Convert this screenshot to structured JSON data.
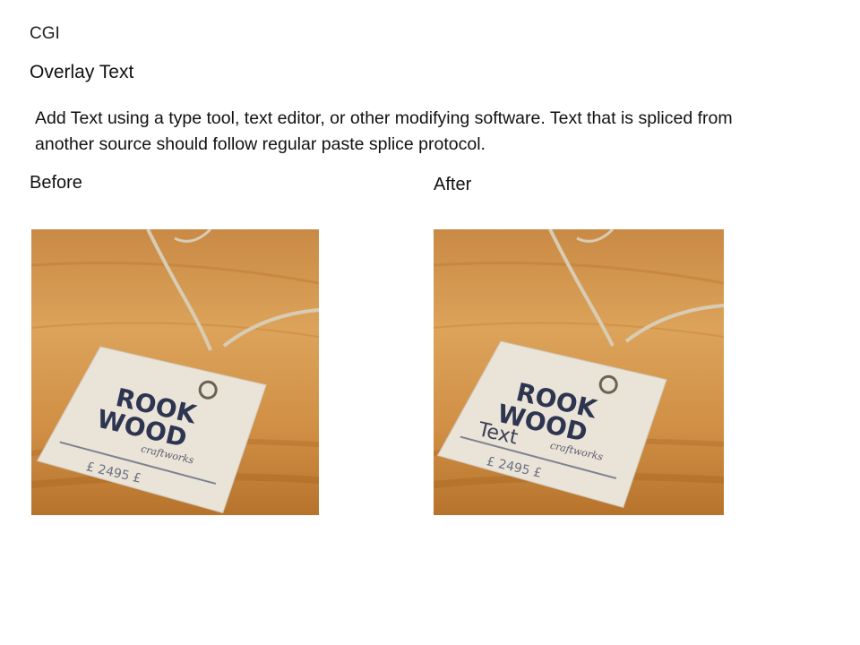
{
  "slide": {
    "section": "CGI",
    "title": "Overlay Text",
    "description": "Add Text using a type tool, text editor, or other modifying software. Text that is spliced from another source should follow regular paste splice protocol.",
    "before_label": "Before",
    "after_label": "After"
  },
  "images": {
    "before": {
      "tag_line1": "ROOK",
      "tag_line2": "WOOD",
      "tag_script": "craftworks",
      "tag_price": "£ 2495 £"
    },
    "after": {
      "tag_line1": "ROOK",
      "tag_line2": "WOOD",
      "tag_script": "craftworks",
      "tag_price": "£ 2495 £",
      "overlay_text": "Text"
    }
  },
  "colors": {
    "wood_light": "#d99a4c",
    "wood_dark": "#a8641f",
    "tag": "#e9e3d8",
    "ink": "#2e3550",
    "string": "#d8ccb4"
  }
}
